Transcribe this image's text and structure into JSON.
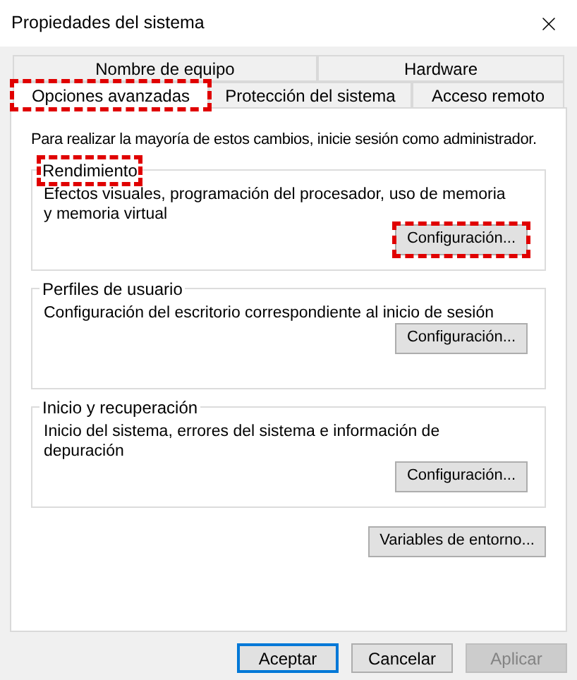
{
  "window": {
    "title": "Propiedades del sistema"
  },
  "tab_rows": [
    [
      {
        "label": "Nombre de equipo",
        "selected": false,
        "highlighted": false
      },
      {
        "label": "Hardware",
        "selected": false,
        "highlighted": false
      }
    ],
    [
      {
        "label": "Opciones avanzadas",
        "selected": true,
        "highlighted": true
      },
      {
        "label": "Protección del sistema",
        "selected": false,
        "highlighted": false
      },
      {
        "label": "Acceso remoto",
        "selected": false,
        "highlighted": false
      }
    ]
  ],
  "notice": "Para realizar la mayoría de estos cambios, inicie sesión como administrador.",
  "groups": [
    {
      "title": "Rendimiento",
      "highlighted": true,
      "description": "Efectos visuales, programación del procesador, uso de memoria y memoria virtual",
      "button": {
        "label": "Configuración...",
        "highlighted": true
      }
    },
    {
      "title": "Perfiles de usuario",
      "highlighted": false,
      "description": "Configuración del escritorio correspondiente al inicio de sesión",
      "button": {
        "label": "Configuración...",
        "highlighted": false
      }
    },
    {
      "title": "Inicio y recuperación",
      "highlighted": false,
      "description": "Inicio del sistema, errores del sistema e información de depuración",
      "button": {
        "label": "Configuración...",
        "highlighted": false
      }
    }
  ],
  "env_button": "Variables de entorno...",
  "buttons": [
    {
      "label": "Aceptar",
      "default": true,
      "disabled": false
    },
    {
      "label": "Cancelar",
      "default": false,
      "disabled": false
    },
    {
      "label": "Aplicar",
      "default": false,
      "disabled": true
    }
  ]
}
